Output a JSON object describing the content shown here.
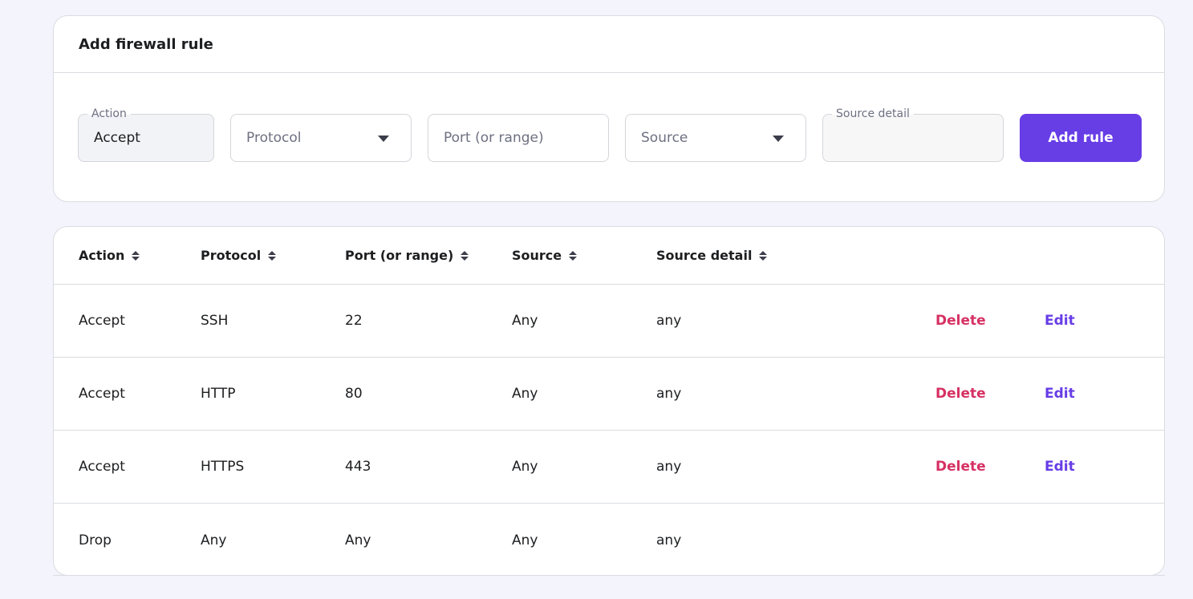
{
  "add_form": {
    "title": "Add firewall rule",
    "action": {
      "label": "Action",
      "value": "Accept"
    },
    "protocol": {
      "placeholder": "Protocol"
    },
    "port": {
      "placeholder": "Port (or range)"
    },
    "source": {
      "placeholder": "Source"
    },
    "source_detail": {
      "label": "Source detail",
      "value": ""
    },
    "add_button": "Add rule"
  },
  "table": {
    "headers": [
      "Action",
      "Protocol",
      "Port (or range)",
      "Source",
      "Source detail"
    ],
    "rows": [
      {
        "action": "Accept",
        "protocol": "SSH",
        "port": "22",
        "source": "Any",
        "detail": "any",
        "delete": "Delete",
        "edit": "Edit"
      },
      {
        "action": "Accept",
        "protocol": "HTTP",
        "port": "80",
        "source": "Any",
        "detail": "any",
        "delete": "Delete",
        "edit": "Edit"
      },
      {
        "action": "Accept",
        "protocol": "HTTPS",
        "port": "443",
        "source": "Any",
        "detail": "any",
        "delete": "Delete",
        "edit": "Edit"
      },
      {
        "action": "Drop",
        "protocol": "Any",
        "port": "Any",
        "source": "Any",
        "detail": "any"
      }
    ]
  },
  "colors": {
    "accent": "#673de6",
    "danger": "#d63163",
    "background": "#f4f4fd"
  }
}
